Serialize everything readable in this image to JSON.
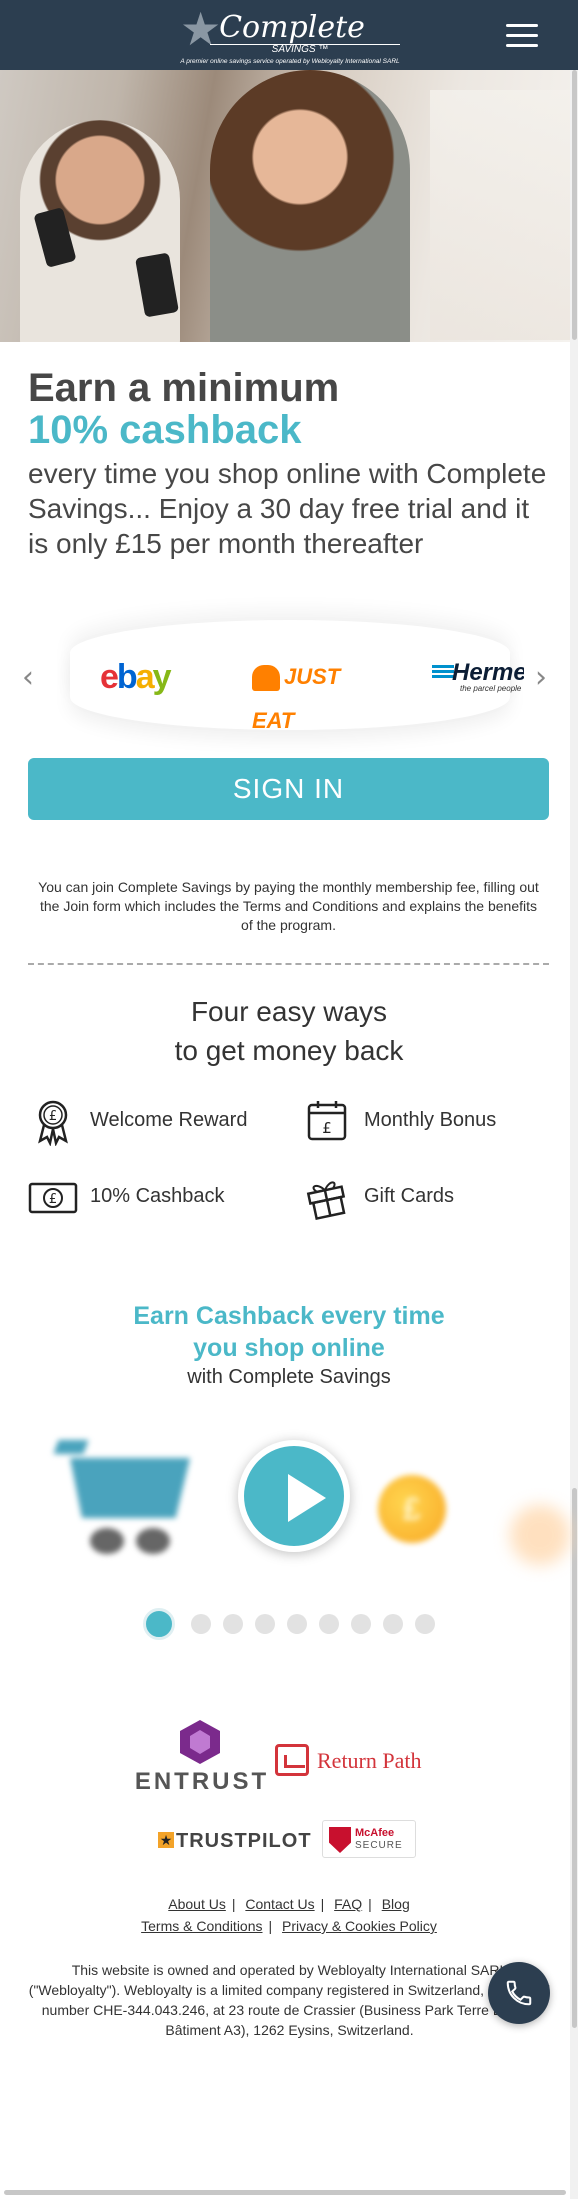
{
  "header": {
    "logo_main": "Complete",
    "logo_sub": "SAVINGS ™",
    "logo_tagline": "A premier online savings service operated by Webloyalty International SARL",
    "menu_icon": "hamburger-menu-icon"
  },
  "intro": {
    "title": "Earn a minimum",
    "accent": "10% cashback",
    "body": "every time you shop online with Complete Savings... Enjoy a 30 day free trial and it is only £15 per month thereafter"
  },
  "brands": {
    "items": [
      "ebay",
      "JUST EAT",
      "Hermes"
    ],
    "hermes_slogan": "the parcel people",
    "prev_icon": "chevron-left-icon",
    "next_icon": "chevron-right-icon"
  },
  "signin": {
    "label": "SIGN IN"
  },
  "join_text": "You can join Complete Savings by paying the monthly membership fee, filling out the Join form which includes the Terms and Conditions and explains the benefits of the program.",
  "ways": {
    "title_line1": "Four easy ways",
    "title_line2": "to get money back",
    "items": [
      {
        "label": "Welcome Reward",
        "icon": "award-ribbon-icon"
      },
      {
        "label": "Monthly Bonus",
        "icon": "calendar-pound-icon"
      },
      {
        "label": "10% Cashback",
        "icon": "banknote-icon"
      },
      {
        "label": "Gift Cards",
        "icon": "gift-icon"
      }
    ]
  },
  "earn": {
    "line1": "Earn Cashback every time",
    "line2": "you shop online",
    "line3": "with Complete Savings",
    "coin_symbol": "£"
  },
  "carousel": {
    "total_slides": 9,
    "active_index": 0
  },
  "trust": {
    "entrust": "ENTRUST",
    "returnpath": "Return Path",
    "trustpilot": "TRUSTPILOT",
    "mcafee_line1": "McAfee",
    "mcafee_line2": "SECURE"
  },
  "footer": {
    "links_row1": [
      "About Us",
      "Contact Us",
      "FAQ",
      "Blog"
    ],
    "links_row2": [
      "Terms & Conditions",
      "Privacy & Cookies Policy"
    ],
    "legal": "This website is owned and operated by Webloyalty International SARL (\"Webloyalty\"). Webloyalty is a limited company registered in Switzerland, registered number CHE-344.043.246, at 23 route de Crassier (Business Park Terre Bonne, Bâtiment A3), 1262 Eysins, Switzerland.",
    "phone_icon": "phone-icon"
  },
  "colors": {
    "header_bg": "#2c3e50",
    "accent": "#4bb8c8",
    "text": "#333333"
  }
}
